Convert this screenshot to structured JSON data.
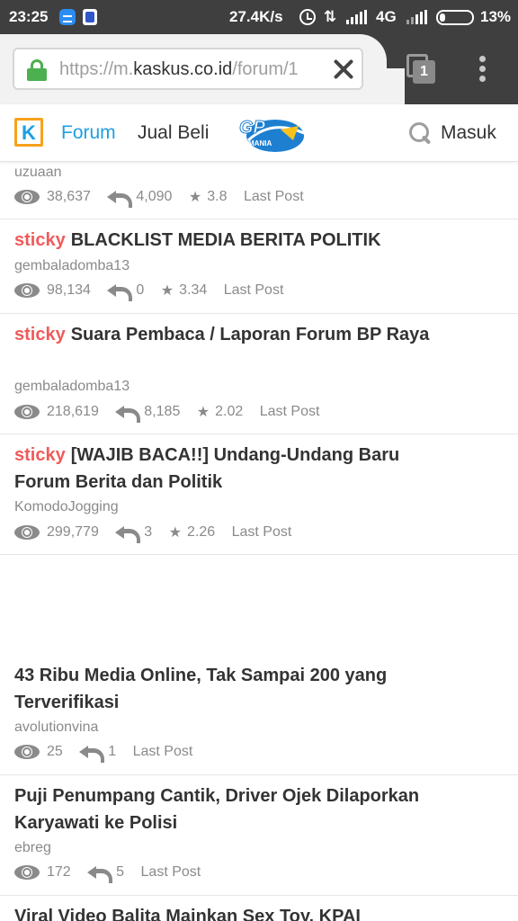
{
  "status_bar": {
    "time": "23:25",
    "speed": "27.4K/s",
    "network": "4G",
    "battery": "13%"
  },
  "browser": {
    "url_prefix": "https://m.",
    "url_host": "kaskus.co.id",
    "url_suffix": "/forum/1",
    "tab_count": "1",
    "accent": "#f26522"
  },
  "header": {
    "logo_letter": "K",
    "nav_forum": "Forum",
    "nav_jual_beli": "Jual Beli",
    "gp_logo_text": "GP",
    "gp_logo_sub": "MANIA",
    "login": "Masuk"
  },
  "sticky_label": "sticky",
  "threads": [
    {
      "sticky": false,
      "title": "",
      "author": "uzuaan",
      "views": "38,637",
      "replies": "4,090",
      "rating": "3.8",
      "last_post": "Last Post"
    },
    {
      "sticky": true,
      "title": "BLACKLIST MEDIA BERITA POLITIK",
      "author": "gembaladomba13",
      "views": "98,134",
      "replies": "0",
      "rating": "3.34",
      "last_post": "Last Post"
    },
    {
      "sticky": true,
      "title": "Suara Pembaca / Laporan Forum BP Raya",
      "author": "gembaladomba13",
      "views": "218,619",
      "replies": "8,185",
      "rating": "2.02",
      "last_post": "Last Post"
    },
    {
      "sticky": true,
      "title": "[WAJIB BACA!!] Undang-Undang Baru Forum Berita dan Politik",
      "author": "KomodoJogging",
      "views": "299,779",
      "replies": "3",
      "rating": "2.26",
      "last_post": "Last Post"
    },
    {
      "sticky": false,
      "title": "43 Ribu Media Online, Tak Sampai 200 yang Terverifikasi",
      "author": "avolutionvina",
      "views": "25",
      "replies": "1",
      "last_post": "Last Post"
    },
    {
      "sticky": false,
      "title": "Puji Penumpang Cantik, Driver Ojek Dilaporkan Karyawati ke Polisi",
      "author": "ebreg",
      "views": "172",
      "replies": "5",
      "last_post": "Last Post"
    },
    {
      "sticky": false,
      "title": "Viral Video Balita Mainkan Sex Toy, KPAI",
      "author": "",
      "views": "",
      "replies": "",
      "last_post": ""
    }
  ]
}
